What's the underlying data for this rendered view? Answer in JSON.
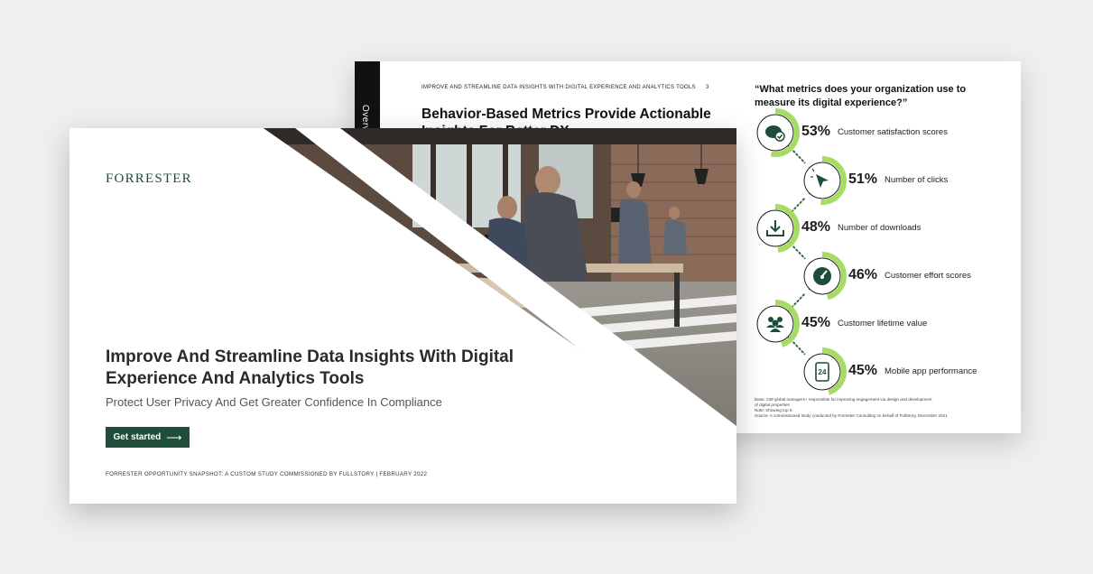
{
  "back_page": {
    "side_tab": "Overview",
    "running_head": "IMPROVE AND STREAMLINE DATA INSIGHTS WITH DIGITAL EXPERIENCE AND ANALYTICS TOOLS",
    "page_number": "3",
    "title": "Behavior-Based Metrics Provide Actionable Insights For Better DX",
    "question": "“What metrics does your organization use to measure its digital experience?”",
    "metrics": [
      {
        "percent": "53%",
        "value": 53,
        "label": "Customer satisfaction scores",
        "icon": "chat-check-icon"
      },
      {
        "percent": "51%",
        "value": 51,
        "label": "Number of clicks",
        "icon": "cursor-click-icon"
      },
      {
        "percent": "48%",
        "value": 48,
        "label": "Number of downloads",
        "icon": "download-icon"
      },
      {
        "percent": "46%",
        "value": 46,
        "label": "Customer effort scores",
        "icon": "gauge-icon"
      },
      {
        "percent": "45%",
        "value": 45,
        "label": "Customer lifetime value",
        "icon": "people-icon"
      },
      {
        "percent": "45%",
        "value": 45,
        "label": "Mobile app performance",
        "icon": "mobile-24-icon"
      }
    ],
    "footnote": {
      "base": "Base: 239 global managers+ responsible for improving engagement via design and development",
      "base2": "of digital properties",
      "note": "Note: Showing top 6.",
      "source": "Source: A commissioned study conducted by Forrester Consulting on behalf of FullStory, December 2021"
    }
  },
  "front_page": {
    "logo": "FORRESTER",
    "title": "Improve And Streamline Data Insights With Digital Experience And Analytics Tools",
    "subtitle": "Protect User Privacy And Get Greater Confidence In Compliance",
    "cta_label": "Get started",
    "cta_arrow": "⟶",
    "footer": "FORRESTER OPPORTUNITY SNAPSHOT: A CUSTOM STUDY COMMISSIONED BY FULLSTORY | FEBRUARY 2022"
  },
  "colors": {
    "brand_green": "#1e4d3a",
    "ring_green": "#a6dc63",
    "dotted_green": "#2f6a49",
    "icon_dark": "#1e4d3a"
  }
}
